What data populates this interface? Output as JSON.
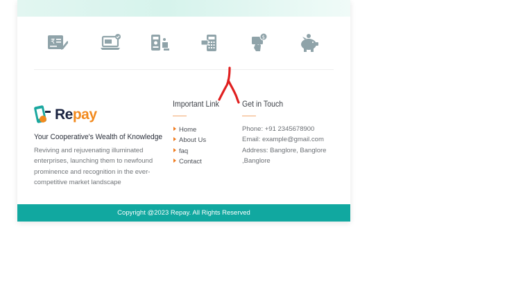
{
  "feature_icons": [
    {
      "icon": "loan-document-rupee-icon"
    },
    {
      "icon": "online-payment-laptop-icon"
    },
    {
      "icon": "mobile-banking-icon"
    },
    {
      "icon": "card-payment-terminal-icon"
    },
    {
      "icon": "tap-to-pay-coin-icon"
    },
    {
      "icon": "piggy-bank-savings-icon"
    }
  ],
  "brand": {
    "logo_part1": "Re",
    "logo_part2": "pay",
    "tagline": "Your Cooperative's Wealth of Knowledge",
    "description": "Reviving and rejuvenating illuminated enterprises, launching them to newfound prominence and recognition in the ever-competitive market landscape"
  },
  "important_links": {
    "title": "Important Link",
    "items": [
      "Home",
      "About Us",
      "faq",
      "Contact"
    ]
  },
  "contact": {
    "title": "Get in Touch",
    "phone": "Phone: +91 2345678900",
    "email": "Email: example@gmail.com",
    "address": "Address: Banglore, Banglore ,Banglore"
  },
  "footer": {
    "copyright": "Copyright @2023 Repay. All Rights Reserved"
  },
  "colors": {
    "teal": "#11a8a0",
    "accent_orange": "#f07b1e",
    "icon_gray": "#8fa3a9",
    "annotation_red": "#e02020"
  }
}
